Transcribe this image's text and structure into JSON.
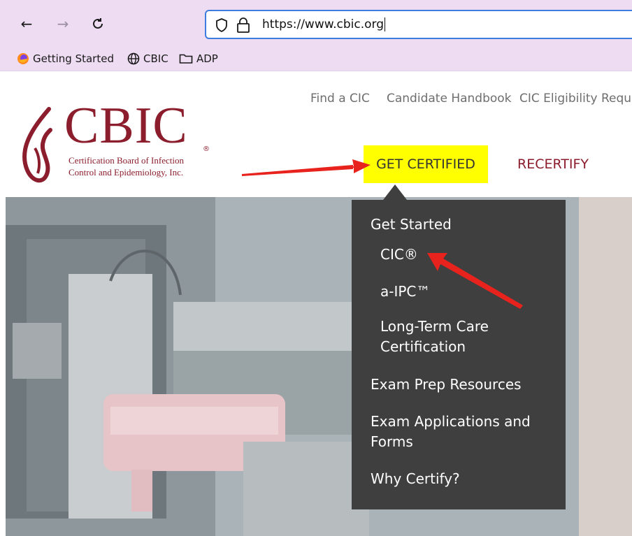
{
  "browser": {
    "back_icon": "back-arrow-icon",
    "forward_icon": "forward-arrow-icon",
    "reload_icon": "reload-icon",
    "url": "https://www.cbic.org",
    "bookmarks": [
      {
        "label": "Getting Started",
        "icon": "firefox-icon"
      },
      {
        "label": "CBIC",
        "icon": "globe-icon"
      },
      {
        "label": "ADP",
        "icon": "folder-icon"
      }
    ]
  },
  "site": {
    "logo": {
      "word": "CBIC",
      "registered": "®",
      "subtitle_line1": "Certification Board of Infection",
      "subtitle_line2": "Control and Epidemiology, Inc.",
      "brand_color": "#8b1d2c"
    },
    "utility_links": [
      "Find a CIC",
      "Candidate Handbook",
      "CIC Eligibility Requ"
    ],
    "main_nav": {
      "get_certified": "GET CERTIFIED",
      "recertify": "RECERTIFY",
      "highlight_color": "#ffff00"
    },
    "dropdown": {
      "heading": "Get Started",
      "sub_items": [
        "CIC®",
        "a-IPC™",
        "Long-Term Care",
        "Certification"
      ],
      "items": [
        "Exam Prep Resources",
        "Exam Applications and",
        "Forms",
        "Why Certify?"
      ]
    },
    "annotation_color": "#e8231d"
  }
}
